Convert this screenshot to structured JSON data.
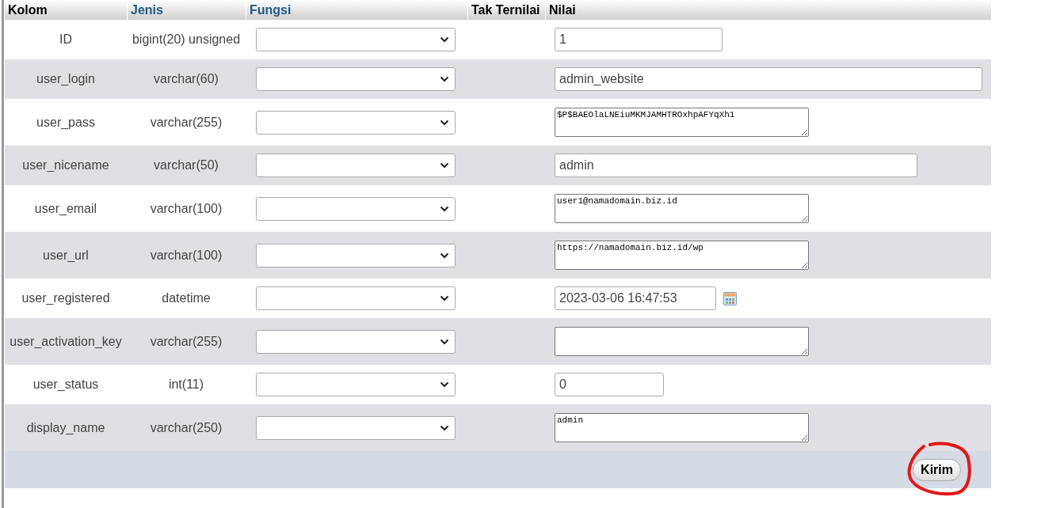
{
  "table": {
    "columns": [
      {
        "label": "Kolom",
        "link": false
      },
      {
        "label": "Jenis",
        "link": true
      },
      {
        "label": "Fungsi",
        "link": true
      },
      {
        "label": "Tak Ternilai",
        "link": false
      },
      {
        "label": "Nilai",
        "link": false
      }
    ],
    "rows": [
      {
        "column": "ID",
        "type": "bigint(20) unsigned",
        "kind": "input",
        "value": "1"
      },
      {
        "column": "user_login",
        "type": "varchar(60)",
        "kind": "input",
        "value": "admin_website"
      },
      {
        "column": "user_pass",
        "type": "varchar(255)",
        "kind": "textarea",
        "value": "$P$BAEOlaLNEiuMKMJAMHTROxhpAFYqXh1"
      },
      {
        "column": "user_nicename",
        "type": "varchar(50)",
        "kind": "input",
        "value": "admin"
      },
      {
        "column": "user_email",
        "type": "varchar(100)",
        "kind": "textarea",
        "value": "user1@namadomain.biz.id"
      },
      {
        "column": "user_url",
        "type": "varchar(100)",
        "kind": "textarea",
        "value": "https://namadomain.biz.id/wp"
      },
      {
        "column": "user_registered",
        "type": "datetime",
        "kind": "datetime",
        "value": "2023-03-06 16:47:53"
      },
      {
        "column": "user_activation_key",
        "type": "varchar(255)",
        "kind": "textarea"
      },
      {
        "column": "user_status",
        "type": "int(11)",
        "kind": "input",
        "value": "0"
      },
      {
        "column": "display_name",
        "type": "varchar(250)",
        "kind": "textarea",
        "value": "admin"
      }
    ]
  },
  "submit": {
    "label": "Kirim",
    "circled": true
  }
}
